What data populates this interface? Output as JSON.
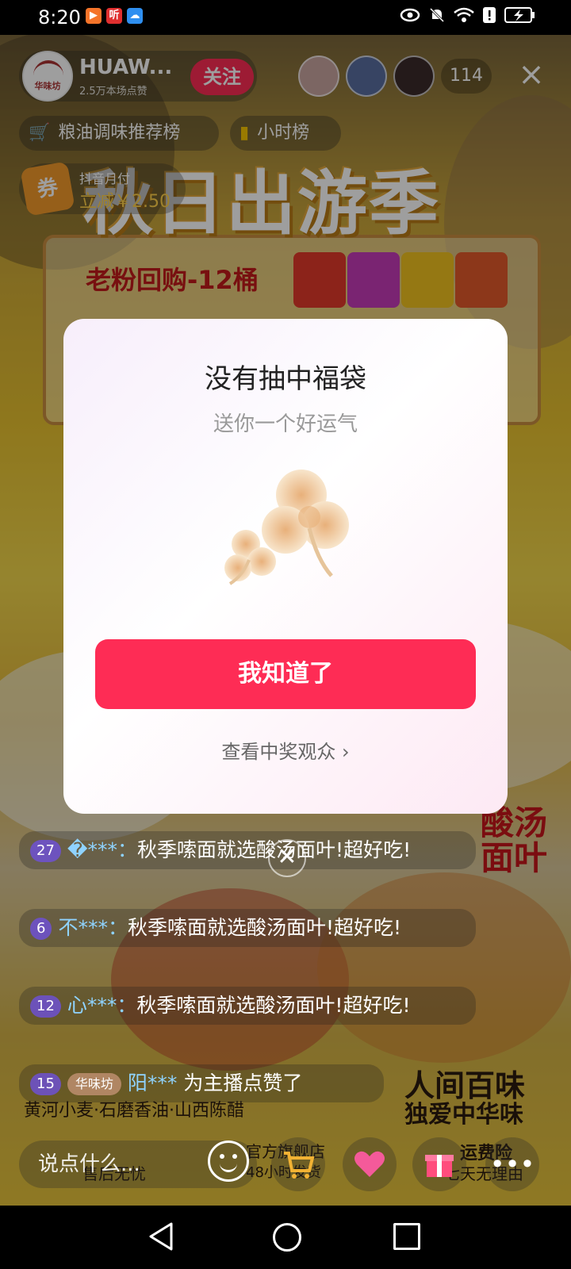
{
  "status_bar": {
    "time": "8:20",
    "apps": [
      {
        "icon": "bilibili-icon",
        "label": "▶",
        "color": "#f5742a"
      },
      {
        "icon": "ting-icon",
        "label": "听",
        "color": "#e02f2f"
      },
      {
        "icon": "cloud-icon",
        "label": "☁",
        "color": "#2f8ff0"
      }
    ],
    "icons": [
      "eye-icon",
      "bell-muted-icon",
      "wifi-icon",
      "alert-icon",
      "battery-charging-icon"
    ]
  },
  "host": {
    "logo_text": "华味坊",
    "name": "HUAW...",
    "likes": "2.5万本场点赞",
    "follow_label": "关注"
  },
  "viewers": {
    "count": "114"
  },
  "chips": {
    "ranking": "粮油调味推荐榜",
    "hourly": "小时榜"
  },
  "coupon": {
    "badge": "券",
    "title": "抖音月付",
    "desc": "立减￥2.50"
  },
  "banner": {
    "title": "秋日出游季",
    "sub": "老粉回购-12桶"
  },
  "modal": {
    "title": "没有抽中福袋",
    "subtitle": "送你一个好运气",
    "confirm_label": "我知道了",
    "view_winners_label": "查看中奖观众 ›"
  },
  "comments": [
    {
      "level": "27",
      "user": "�***：",
      "text": "秋季嗦面就选酸汤面叶!超好吃!"
    },
    {
      "level": "6",
      "user": "不***：",
      "text": "秋季嗦面就选酸汤面叶!超好吃!"
    },
    {
      "level": "12",
      "user": "心***：",
      "text": "秋季嗦面就选酸汤面叶!超好吃!"
    }
  ],
  "like_event": {
    "level": "15",
    "fan_badge": "华味坊",
    "user": "阳***",
    "text": "为主播点赞了"
  },
  "bottom_bar": {
    "input_placeholder": "说点什么...",
    "icons": [
      "emoji-icon",
      "cart-icon",
      "heart-icon",
      "gift-icon",
      "more-icon"
    ]
  },
  "background_text": {
    "slogan1": "人间百味",
    "slogan2": "独爱中华味",
    "tagline": "黄河小麦·石磨香油·山西陈醋",
    "shop1": "官方旗舰店",
    "shop2": "48小时发货",
    "after_sale": "售后无忧",
    "insurance": "运费险",
    "no_reason": "七天无理由",
    "product": "酸汤面叶"
  },
  "colors": {
    "accent": "#fe2c55",
    "coupon": "#f39a2b"
  }
}
